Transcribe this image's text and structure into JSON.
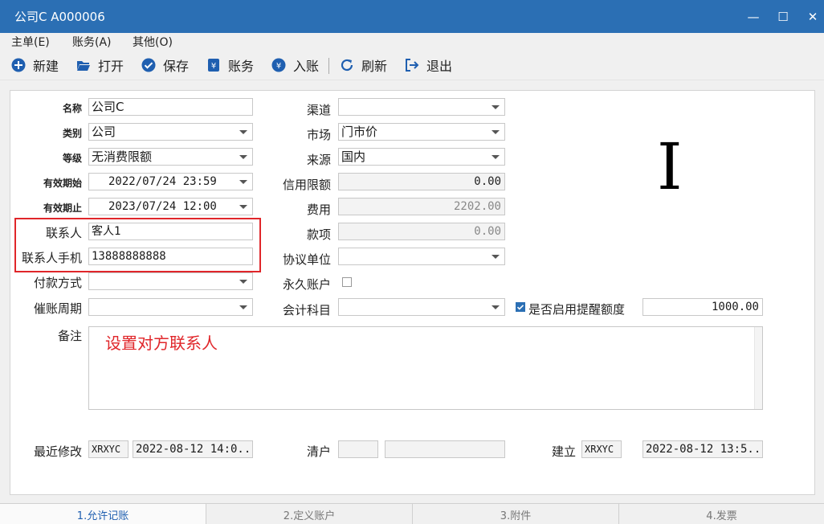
{
  "window": {
    "title": "公司C  A000006",
    "minimize": "—",
    "maximize": "☐",
    "close": "✕"
  },
  "menu": [
    "主单(E)",
    "账务(A)",
    "其他(O)"
  ],
  "toolbar": {
    "new": "新建",
    "open": "打开",
    "save": "保存",
    "account": "账务",
    "post": "入账",
    "refresh": "刷新",
    "exit": "退出"
  },
  "form": {
    "name_label": "名称",
    "name_value": "公司C",
    "category_label": "类别",
    "category_value": "公司",
    "level_label": "等级",
    "level_value": "无消费限额",
    "valid_start_label": "有效期始",
    "valid_start_value": "2022/07/24 23:59",
    "valid_end_label": "有效期止",
    "valid_end_value": "2023/07/24 12:00",
    "contact_label": "联系人",
    "contact_value": "客人1",
    "contact_phone_label": "联系人手机",
    "contact_phone_value": "13888888888",
    "payment_label": "付款方式",
    "payment_value": "",
    "dunning_label": "催账周期",
    "dunning_value": "",
    "channel_label": "渠道",
    "channel_value": "",
    "market_label": "市场",
    "market_value": "门市价",
    "source_label": "来源",
    "source_value": "国内",
    "credit_label": "信用限额",
    "credit_value": "0.00",
    "fee_label": "费用",
    "fee_value": "2202.00",
    "payment_item_label": "款项",
    "payment_item_value": "0.00",
    "agreement_label": "协议单位",
    "agreement_value": "",
    "permanent_label": "永久账户",
    "subject_label": "会计科目",
    "subject_value": "",
    "reminder_label": "是否启用提醒额度",
    "reminder_value": "1000.00",
    "remark_label": "备注",
    "remark_value": "设置对方联系人",
    "modified_label": "最近修改",
    "modified_user": "XRXYC",
    "modified_time": "2022-08-12 14:0...",
    "cleared_label": "清户",
    "cleared_user": "",
    "cleared_time": "",
    "created_label": "建立",
    "created_user": "XRXYC",
    "created_time": "2022-08-12 13:5..."
  },
  "overlay_glyph": "I",
  "tabs": [
    "1.允许记账",
    "2.定义账户",
    "3.附件",
    "4.发票"
  ],
  "colors": {
    "titlebar": "#2b6fb4",
    "highlight_box": "#e0262a",
    "active_tab": "#1f5fb0"
  }
}
